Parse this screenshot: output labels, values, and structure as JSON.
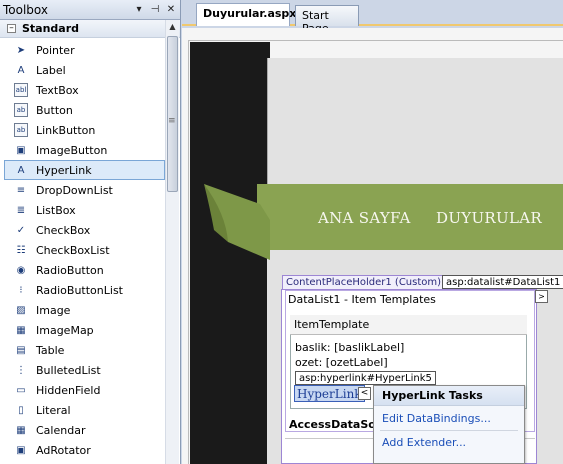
{
  "toolbox": {
    "title": "Toolbox",
    "pin_glyph": "▾",
    "autohide_glyph": "⊣",
    "close_glyph": "✕",
    "group_toggle": "–",
    "group_label": "Standard",
    "items": [
      {
        "label": "Pointer",
        "icon": "pointer-arrow-icon",
        "glyph": "➤"
      },
      {
        "label": "Label",
        "icon": "label-icon",
        "glyph": "A"
      },
      {
        "label": "TextBox",
        "icon": "textbox-icon",
        "glyph": "abl"
      },
      {
        "label": "Button",
        "icon": "button-icon",
        "glyph": "ab"
      },
      {
        "label": "LinkButton",
        "icon": "linkbutton-icon",
        "glyph": "ab"
      },
      {
        "label": "ImageButton",
        "icon": "imagebutton-icon",
        "glyph": "▣"
      },
      {
        "label": "HyperLink",
        "icon": "hyperlink-icon",
        "glyph": "A"
      },
      {
        "label": "DropDownList",
        "icon": "dropdownlist-icon",
        "glyph": "≡"
      },
      {
        "label": "ListBox",
        "icon": "listbox-icon",
        "glyph": "≣"
      },
      {
        "label": "CheckBox",
        "icon": "checkbox-icon",
        "glyph": "✓"
      },
      {
        "label": "CheckBoxList",
        "icon": "checkboxlist-icon",
        "glyph": "☷"
      },
      {
        "label": "RadioButton",
        "icon": "radiobutton-icon",
        "glyph": "◉"
      },
      {
        "label": "RadioButtonList",
        "icon": "radiobuttonlist-icon",
        "glyph": "⁝"
      },
      {
        "label": "Image",
        "icon": "image-icon",
        "glyph": "▨"
      },
      {
        "label": "ImageMap",
        "icon": "imagemap-icon",
        "glyph": "▦"
      },
      {
        "label": "Table",
        "icon": "table-icon",
        "glyph": "▤"
      },
      {
        "label": "BulletedList",
        "icon": "bulletedlist-icon",
        "glyph": "⋮"
      },
      {
        "label": "HiddenField",
        "icon": "hiddenfield-icon",
        "glyph": "▭"
      },
      {
        "label": "Literal",
        "icon": "literal-icon",
        "glyph": "▯"
      },
      {
        "label": "Calendar",
        "icon": "calendar-icon",
        "glyph": "▦"
      },
      {
        "label": "AdRotator",
        "icon": "adrotator-icon",
        "glyph": "▣"
      }
    ],
    "selected_label": "HyperLink"
  },
  "tabs": [
    {
      "label": "Duyurular.aspx*",
      "active": true
    },
    {
      "label": "Start Page",
      "active": false
    }
  ],
  "page": {
    "nav_1": "ANA SAYFA",
    "nav_2": "DUYURULAR",
    "banner_color": "#8aa352",
    "content_placeholder_label": "ContentPlaceHolder1 (Custom)",
    "datalist_tag": "asp:datalist#DataList1",
    "datalist_title": "DataList1 - Item Templates",
    "smart_tag_glyph": ">",
    "item_template_label": "ItemTemplate",
    "line_baslik": "baslik: [baslikLabel]",
    "line_ozet": "ozet: [ozetLabel]",
    "hyperlink_tag": "asp:hyperlink#HyperLink5",
    "hyperlink_text": "HyperLink",
    "hyperlink_smart_glyph": "<",
    "datasource_label": "AccessDataSou"
  },
  "tasks_popup": {
    "title": "HyperLink Tasks",
    "items": [
      "Edit DataBindings...",
      "Add Extender..."
    ]
  }
}
